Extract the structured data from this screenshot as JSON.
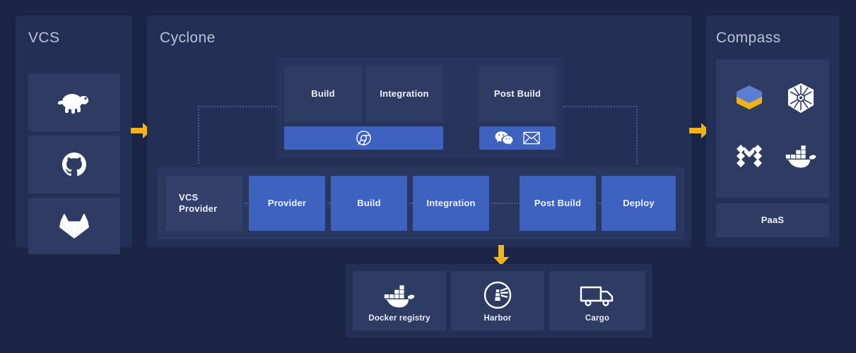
{
  "colors": {
    "background": "#1b2545",
    "panel": "#233055",
    "tile": "#2e3c63",
    "tile_bright": "#3d62c0",
    "tile_muted": "#32406a",
    "arrow": "#f2b316",
    "text": "#eef2fb",
    "title": "#b9c2d8",
    "dotted": "#4a588a"
  },
  "vcs_panel": {
    "title": "VCS",
    "items": [
      {
        "icon": "tortoise-svn-icon",
        "label": ""
      },
      {
        "icon": "github-icon",
        "label": ""
      },
      {
        "icon": "gitlab-icon",
        "label": ""
      }
    ]
  },
  "cyclone_panel": {
    "title": "Cyclone",
    "stage_cards": [
      {
        "label": "Build",
        "icons": []
      },
      {
        "label": "Integration",
        "icons": []
      },
      {
        "label": "Post Build",
        "icons": [
          "wechat-icon",
          "email-icon"
        ]
      }
    ],
    "build_integration_icons": [
      "chrome-icon"
    ],
    "post_build_icons": [
      "wechat-icon",
      "email-icon"
    ],
    "pipeline": [
      {
        "label": "VCS\nProvider",
        "label_line1": "VCS",
        "label_line2": "Provider",
        "style": "muted"
      },
      {
        "label": "Provider",
        "style": "bright"
      },
      {
        "label": "Build",
        "style": "bright"
      },
      {
        "label": "Integration",
        "style": "bright"
      },
      {
        "label": "Post Build",
        "style": "bright"
      },
      {
        "label": "Deploy",
        "style": "bright"
      }
    ]
  },
  "compass_panel": {
    "title": "Compass",
    "icons": [
      {
        "name": "caicloud-icon"
      },
      {
        "name": "kubernetes-icon"
      },
      {
        "name": "mesos-icon"
      },
      {
        "name": "docker-icon"
      }
    ],
    "paas_label": "PaaS"
  },
  "registry_panel": {
    "items": [
      {
        "label": "Docker registry",
        "icon": "docker-icon"
      },
      {
        "label": "Harbor",
        "icon": "harbor-icon"
      },
      {
        "label": "Cargo",
        "icon": "cargo-truck-icon"
      }
    ]
  },
  "arrows": [
    {
      "name": "arrow-vcs-to-cyclone",
      "direction": "right"
    },
    {
      "name": "arrow-cyclone-to-compass",
      "direction": "right"
    },
    {
      "name": "arrow-cyclone-to-registry",
      "direction": "down"
    }
  ]
}
